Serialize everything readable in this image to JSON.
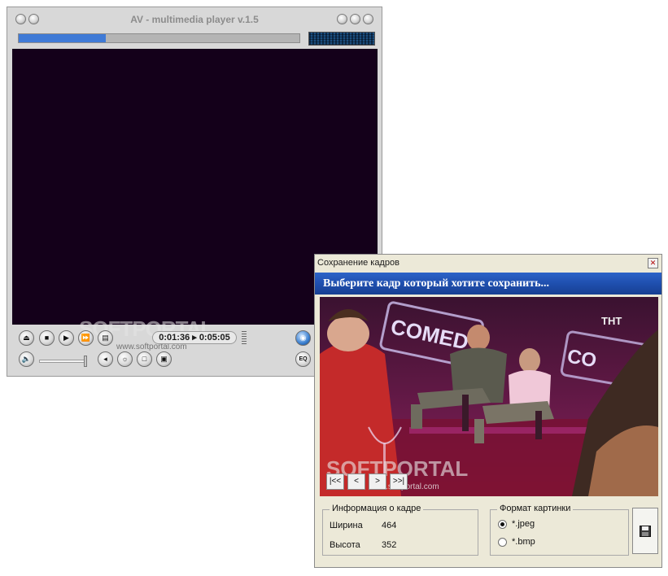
{
  "player": {
    "title": "AV - multimedia player v.1.5",
    "progress": 0.31,
    "time_display": "0:01:36 ▸ 0:05:05",
    "icons": {
      "eject": "eject-icon",
      "stop": "stop-icon",
      "play": "play-icon",
      "forward": "fast-forward-icon",
      "playlist": "playlist-icon",
      "snapshot": "camera-icon",
      "volume": "speaker-icon",
      "audio": "audio-channel-icon",
      "brightness": "brightness-icon",
      "window": "window-icon",
      "fullscreen": "fullscreen-icon",
      "equalizer": "equalizer-icon"
    },
    "eq_label": "EQ",
    "watermark": {
      "brand": "SOFTPORTAL",
      "url": "www.softportal.com"
    }
  },
  "dialog": {
    "title": "Сохранение кадров",
    "banner": "Выберите кадр который хотите сохранить...",
    "nav": [
      "|<<",
      "<",
      ">",
      ">>|"
    ],
    "info_group": {
      "legend": "Информация о кадре",
      "width_label": "Ширина",
      "width_value": "464",
      "height_label": "Высота",
      "height_value": "352"
    },
    "format_group": {
      "legend": "Формат картинки",
      "options": [
        "*.jpeg",
        "*.bmp"
      ],
      "selected": "*.jpeg"
    },
    "frame": {
      "channel_logo": "ТНТ",
      "sign_text": "COMEDY",
      "sign_text_2": "CO"
    },
    "watermark": {
      "brand": "SOFTPORTAL",
      "url": "www.softportal.com"
    }
  },
  "colors": {
    "banner": "#1f4fae",
    "progress": "#3f7ad6",
    "video_bg": "#14001a"
  }
}
